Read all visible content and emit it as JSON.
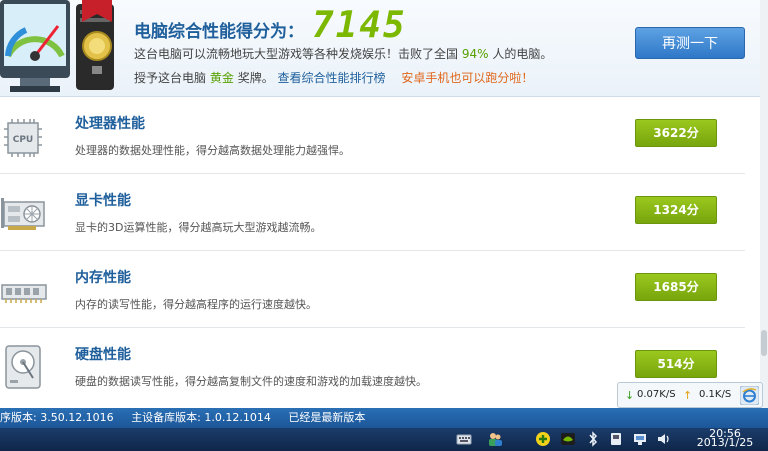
{
  "header": {
    "score_label": "电脑综合性能得分为：",
    "score_value": "7145",
    "desc_prefix": "这台电脑可以流畅地玩大型游戏等各种发烧娱乐！击败了全国",
    "desc_percent": "94%",
    "desc_suffix": "人的电脑。",
    "award_prefix": "授予这台电脑",
    "award_medal": "黄金",
    "award_suffix": "奖牌。",
    "rank_link": "查看综合性能排行榜",
    "android_link": "安卓手机也可以跑分啦！",
    "retest_button": "再测一下"
  },
  "items": [
    {
      "title": "处理器性能",
      "desc": "处理器的数据处理性能，得分越高数据处理能力越强悍。",
      "score": "3622分",
      "icon": "cpu-icon",
      "icon_text": "CPU"
    },
    {
      "title": "显卡性能",
      "desc": "显卡的3D运算性能，得分越高玩大型游戏越流畅。",
      "score": "1324分",
      "icon": "graphics-card-icon"
    },
    {
      "title": "内存性能",
      "desc": "内存的读写性能，得分越高程序的运行速度越快。",
      "score": "1685分",
      "icon": "memory-icon"
    },
    {
      "title": "硬盘性能",
      "desc": "硬盘的数据读写性能，得分越高复制文件的速度和游戏的加载速度越快。",
      "score": "514分",
      "icon": "hard-disk-icon"
    }
  ],
  "net_monitor": {
    "download": "0.07K/S",
    "upload": "0.1K/S"
  },
  "status_bar": {
    "program_version": "序版本: 3.50.12.1016",
    "db_version": "主设备库版本: 1.0.12.1014",
    "update_state": "已经是最新版本"
  },
  "taskbar": {
    "time": "20:56",
    "date": "2013/1/25"
  },
  "colors": {
    "accent_blue": "#1f5f9c",
    "score_green": "#7cb800",
    "badge_green": "#8ab616",
    "link_orange": "#e0661a"
  }
}
